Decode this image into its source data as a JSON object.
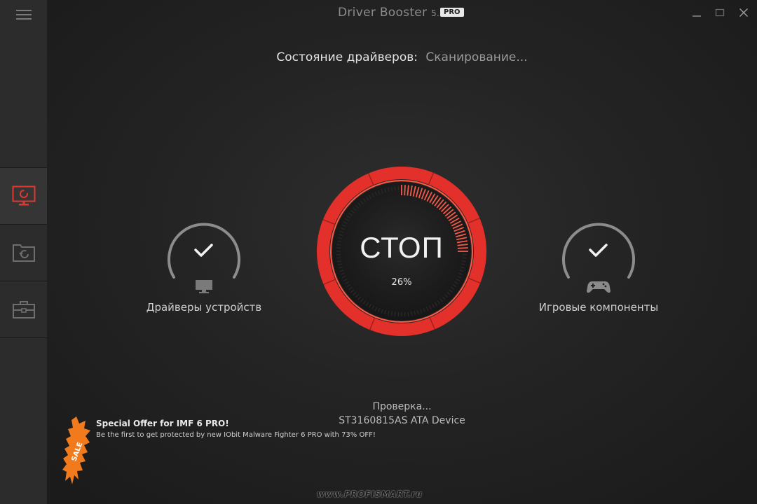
{
  "app": {
    "title": "Driver Booster",
    "version": "5.5",
    "badge": "PRO"
  },
  "sidebar": {
    "menu_icon": "hamburger-icon",
    "items": [
      {
        "icon": "monitor-scan-icon",
        "active": true
      },
      {
        "icon": "restore-icon",
        "active": false
      },
      {
        "icon": "toolbox-icon",
        "active": false
      }
    ]
  },
  "status": {
    "label": "Состояние драйверов:",
    "value": "Сканирование..."
  },
  "gauges": {
    "left": {
      "caption": "Драйверы устройств",
      "icon": "monitor-icon",
      "check": "checkmark-icon"
    },
    "right": {
      "caption": "Игровые компоненты",
      "icon": "gamepad-icon",
      "check": "checkmark-icon"
    }
  },
  "scan_button": {
    "label": "СТОП",
    "progress_text": "26%",
    "progress": 0.26
  },
  "scan_info": {
    "line1": "Проверка...",
    "line2": "ST3160815AS ATA Device"
  },
  "offer": {
    "title": "Special Offer for IMF 6 PRO!",
    "text": "Be the first to get protected by new IObit Malware Fighter 6 PRO with 73% OFF!",
    "badge_text": "SALE"
  },
  "watermark": "www.PROFISMART.ru",
  "colors": {
    "accent": "#e02b2b",
    "accent_light": "#f25a4a",
    "ring_dark": "#141414",
    "gauge_grey": "#8a8a8a"
  }
}
